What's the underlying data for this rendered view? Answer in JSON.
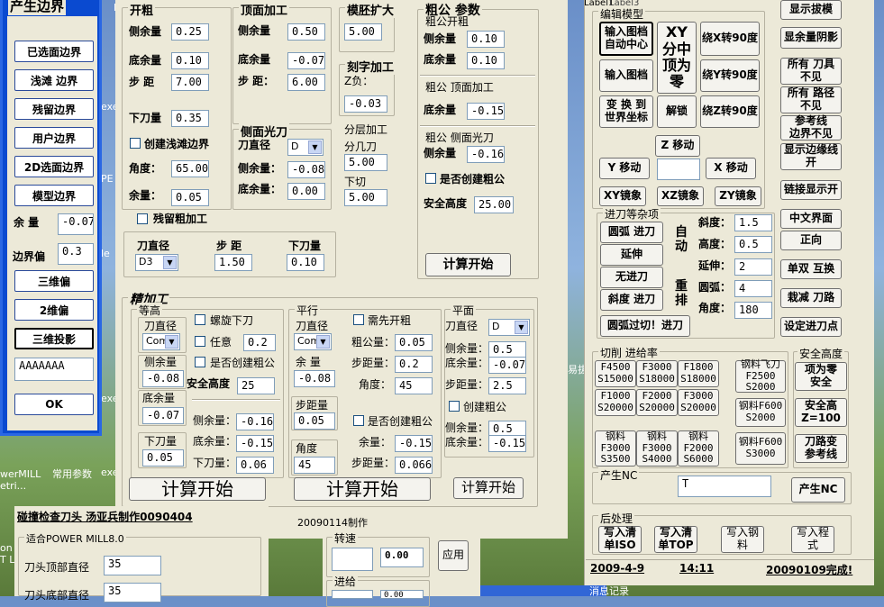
{
  "left": {
    "title": "产生边界",
    "buttons": [
      "已选面边界",
      "浅滩 边界",
      "残留边界",
      "用户边界",
      "2D选面边界",
      "模型边界"
    ],
    "yuliang_label": "余 量",
    "yuliang": "-0.07",
    "bianjie_label": "边界偏",
    "bianjie": "0.3",
    "buttons2": [
      "三维偏",
      "2维偏",
      "三维投影"
    ],
    "text": "AAAAAAA",
    "ok": "OK"
  },
  "desktop": {
    "pe": "PE",
    "le": "le",
    "exe": "exe",
    "mill": "werMILL\netri...",
    "cyfs": "常用参数",
    "exe2": "exe",
    "ct": "ct",
    "on": "on\nT L",
    "ex2": "exe",
    "la": "La",
    "ybj": "易拔"
  },
  "kc": {
    "title": "开粗",
    "ce_l": "侧余量",
    "ce": "0.25",
    "di_l": "底余量",
    "di": "0.10",
    "bu_l": "步 距",
    "bu": "7.00",
    "xd_l": "下刀量",
    "xd": "0.35",
    "cjq": "创建浅滩边界",
    "jd_l": "角度：",
    "jd": "65.00",
    "yl_l": "余量：",
    "yl": "0.05"
  },
  "dm": {
    "title": "顶面加工",
    "ce_l": "侧余量",
    "ce": "0.50",
    "di_l": "底余量",
    "di": "-0.07",
    "bu_l": "步 距：",
    "bu": "6.00"
  },
  "cmgd": {
    "title": "侧面光刀",
    "dj_l": "刀直径",
    "dj": "D",
    "ce_l": "侧余量：",
    "ce": "-0.08",
    "di_l": "底余量：",
    "di": "0.00"
  },
  "mp": {
    "title": "模胚扩大",
    "v": "5.00"
  },
  "kz": {
    "title": "刻字加工",
    "zf": "Z负：",
    "v": "-0.03"
  },
  "fc": {
    "title": "分层加工",
    "fj": "分几刀",
    "v1": "5.00",
    "xq": "下切",
    "v2": "5.00"
  },
  "cl": {
    "label": "残留粗加工"
  },
  "tool": {
    "dj": "刀直径",
    "dj_v": "D3",
    "bj": "步 距",
    "bj_v": "1.50",
    "xd": "下刀量",
    "xd_v": "0.10"
  },
  "cg": {
    "title": "粗公 参数",
    "kc": "粗公开粗",
    "ce_l": "侧余量",
    "ce": "0.10",
    "di_l": "底余量",
    "di": "0.10",
    "dm": "粗公 顶面加工",
    "dm_di_l": "底余量",
    "dm_di": "-0.15",
    "cm": "粗公 侧面光刀",
    "cm_ce_l": "侧余量",
    "cm_ce": "-0.16",
    "sfcj": "是否创建粗公",
    "aq_l": "安全高度",
    "aq": "25.00",
    "start": "计算开始"
  },
  "jjg": {
    "title": "精加工",
    "dg": {
      "title": "等高",
      "dj_l": "刀直径",
      "dj": "Com",
      "ce_l": "侧余量",
      "ce": "-0.08",
      "di_l": "底余量",
      "di": "-0.07",
      "xd_l": "下刀量",
      "xd": "0.05",
      "lxxd": "螺旋下刀",
      "ry": "任意",
      "ry_v": "0.2",
      "sfcj": "是否创建粗公",
      "aq_l": "安全高度",
      "aq": "25",
      "ce2_l": "侧余量：",
      "ce2": "-0.16",
      "di2_l": "底余量：",
      "di2": "-0.15",
      "xd2_l": "下刀量：",
      "xd2": "0.06",
      "start": "计算开始"
    },
    "px": {
      "title": "平行",
      "dj_l": "刀直径",
      "dj": "Com",
      "yl_l": "余 量",
      "yl": "-0.08",
      "bj_l": "步距量",
      "bj": "0.05",
      "jd_l": "角度",
      "jd": "45",
      "xxkc": "需先开粗",
      "cgl_l": "粗公量：",
      "cgl": "0.05",
      "bjl_l": "步距量：",
      "bjl": "0.2",
      "jd2_l": "角度：",
      "jd2": "45",
      "sfcj": "是否创建粗公",
      "yl2_l": "余量：",
      "yl2": "-0.15",
      "bjl2_l": "步距量：",
      "bjl2": "0.066",
      "start": "计算开始"
    },
    "pm": {
      "title": "平面",
      "dj_l": "刀直径",
      "dj": "D",
      "ce_l": "侧余量：",
      "ce": "0.5",
      "di_l": "底余量：",
      "di": "-0.07",
      "bj_l": "步距量：",
      "bj": "2.5",
      "cjcg": "创建粗公",
      "ce2_l": "侧余量：",
      "ce2": "0.5",
      "di2_l": "底余量：",
      "di2": "-0.15",
      "start": "计算开始"
    }
  },
  "bottom": {
    "title": "碰撞检查刀头 汤亚兵制作0090404",
    "date": "20090114制作",
    "power": "适合POWER MILL8.0",
    "dtdm": "刀头顶部直径",
    "dtdm_v": "35",
    "dtdb": "刀头底部直径",
    "dtdb_v": "35",
    "zs": "转速",
    "zs_v": "0.00",
    "jj": "进给",
    "jj_v": "0.00",
    "apply": "应用",
    "tb": "消息记录"
  },
  "edit": {
    "title": "编辑模型",
    "label1": "Label1",
    "label3": "Label3",
    "b1": "输入图档\n自动中心",
    "b2": "XY\n分中\n顶为\n零",
    "b3": "绕X转90度",
    "b4": "输入图档",
    "b5": "绕Y转90度",
    "b6": "变 换 到\n世界坐标",
    "b7": "解锁",
    "b8": "绕Z转90度",
    "zmove": "Z 移动",
    "ymove": "Y 移动",
    "xmove": "X 移动",
    "xy": "XY镜象",
    "xz": "XZ镜象",
    "zy": "ZY镜象"
  },
  "ltr": {
    "title": "进刀等杂项",
    "b1": "圆弧 进刀",
    "b2": "延伸",
    "b3": "无进刀",
    "b4": "斜度 进刀",
    "zd": "自\n动",
    "cp": "重\n排",
    "b5": "圆弧过切！进刀",
    "xd_l": "斜度：",
    "xd": "1.5",
    "gd_l": "高度：",
    "gd": "0.5",
    "ys_l": "延伸：",
    "ys": "2",
    "yh_l": "圆弧：",
    "yh": "4",
    "jd_l": "角度：",
    "jd": "180"
  },
  "right": {
    "b1": "显示拔模",
    "b2": "显余量阴影",
    "b3": "所有 刀具\n不见",
    "b4": "所有 路径\n不见",
    "b5": "参考线\n边界不见",
    "b6": "显示边缘线\n开",
    "b7": "链接显示开",
    "b8": "中文界面",
    "b9": "正向",
    "b10": "单双 互换",
    "b11": "栽减 刀路",
    "b12": "设定进刀点"
  },
  "feed": {
    "title": "切削 进给率",
    "cells": [
      [
        "F4500\nS15000",
        "F3000\nS18000",
        "F1800\nS18000"
      ],
      [
        "F1000\nS20000",
        "F2000\nS20000",
        "F3000\nS20000"
      ],
      [
        "钢料\nF3000\nS3500",
        "钢料\nF3000\nS4000",
        "钢料\nF2000\nS6000"
      ]
    ],
    "side": [
      "钢料飞刀\nF2500\nS2000",
      "钢料F600\nS2000",
      "钢料F600\nS3000"
    ]
  },
  "safe": {
    "title": "安全高度",
    "b1": "项为零\n安全",
    "b2": "安全高\nZ=100",
    "b3": "刀路变\n参考线"
  },
  "nc": {
    "title": "产生NC",
    "v": "T",
    "btn": "产生NC"
  },
  "hcl": {
    "title": "后处理",
    "b1": "写入清\n单ISO",
    "b2": "写入清\n单TOP",
    "b3": "写入钢\n料",
    "b4": "写入程\n式"
  },
  "status": {
    "date": "2009-4-9",
    "time": "14:11",
    "ver": "20090109完成!"
  }
}
